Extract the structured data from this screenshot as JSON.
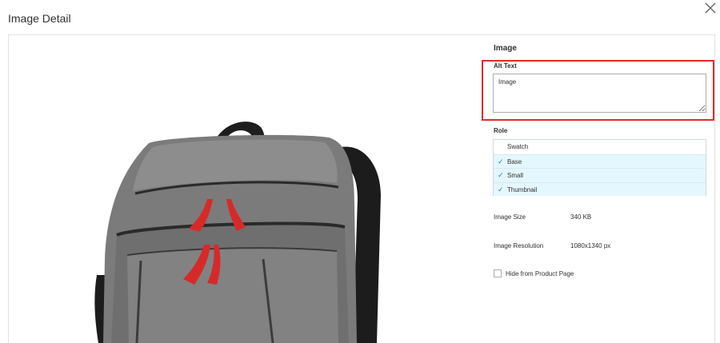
{
  "modal": {
    "title": "Image Detail",
    "close_icon": "close-icon"
  },
  "details": {
    "section_title": "Image",
    "alt_text": {
      "label": "Alt Text",
      "value": "Image"
    },
    "role": {
      "label": "Role",
      "options": [
        {
          "label": "Swatch",
          "selected": false
        },
        {
          "label": "Base",
          "selected": true
        },
        {
          "label": "Small",
          "selected": true
        },
        {
          "label": "Thumbnail",
          "selected": true
        }
      ]
    },
    "image_size": {
      "label": "Image Size",
      "value": "340 KB"
    },
    "image_resolution": {
      "label": "Image Resolution",
      "value": "1080x1340 px"
    },
    "hide_from_product_page": {
      "label": "Hide from Product Page",
      "checked": false
    }
  },
  "colors": {
    "highlight_border": "#e02b27",
    "selected_row": "#e5f7fe",
    "check_mark": "#1979c3"
  }
}
